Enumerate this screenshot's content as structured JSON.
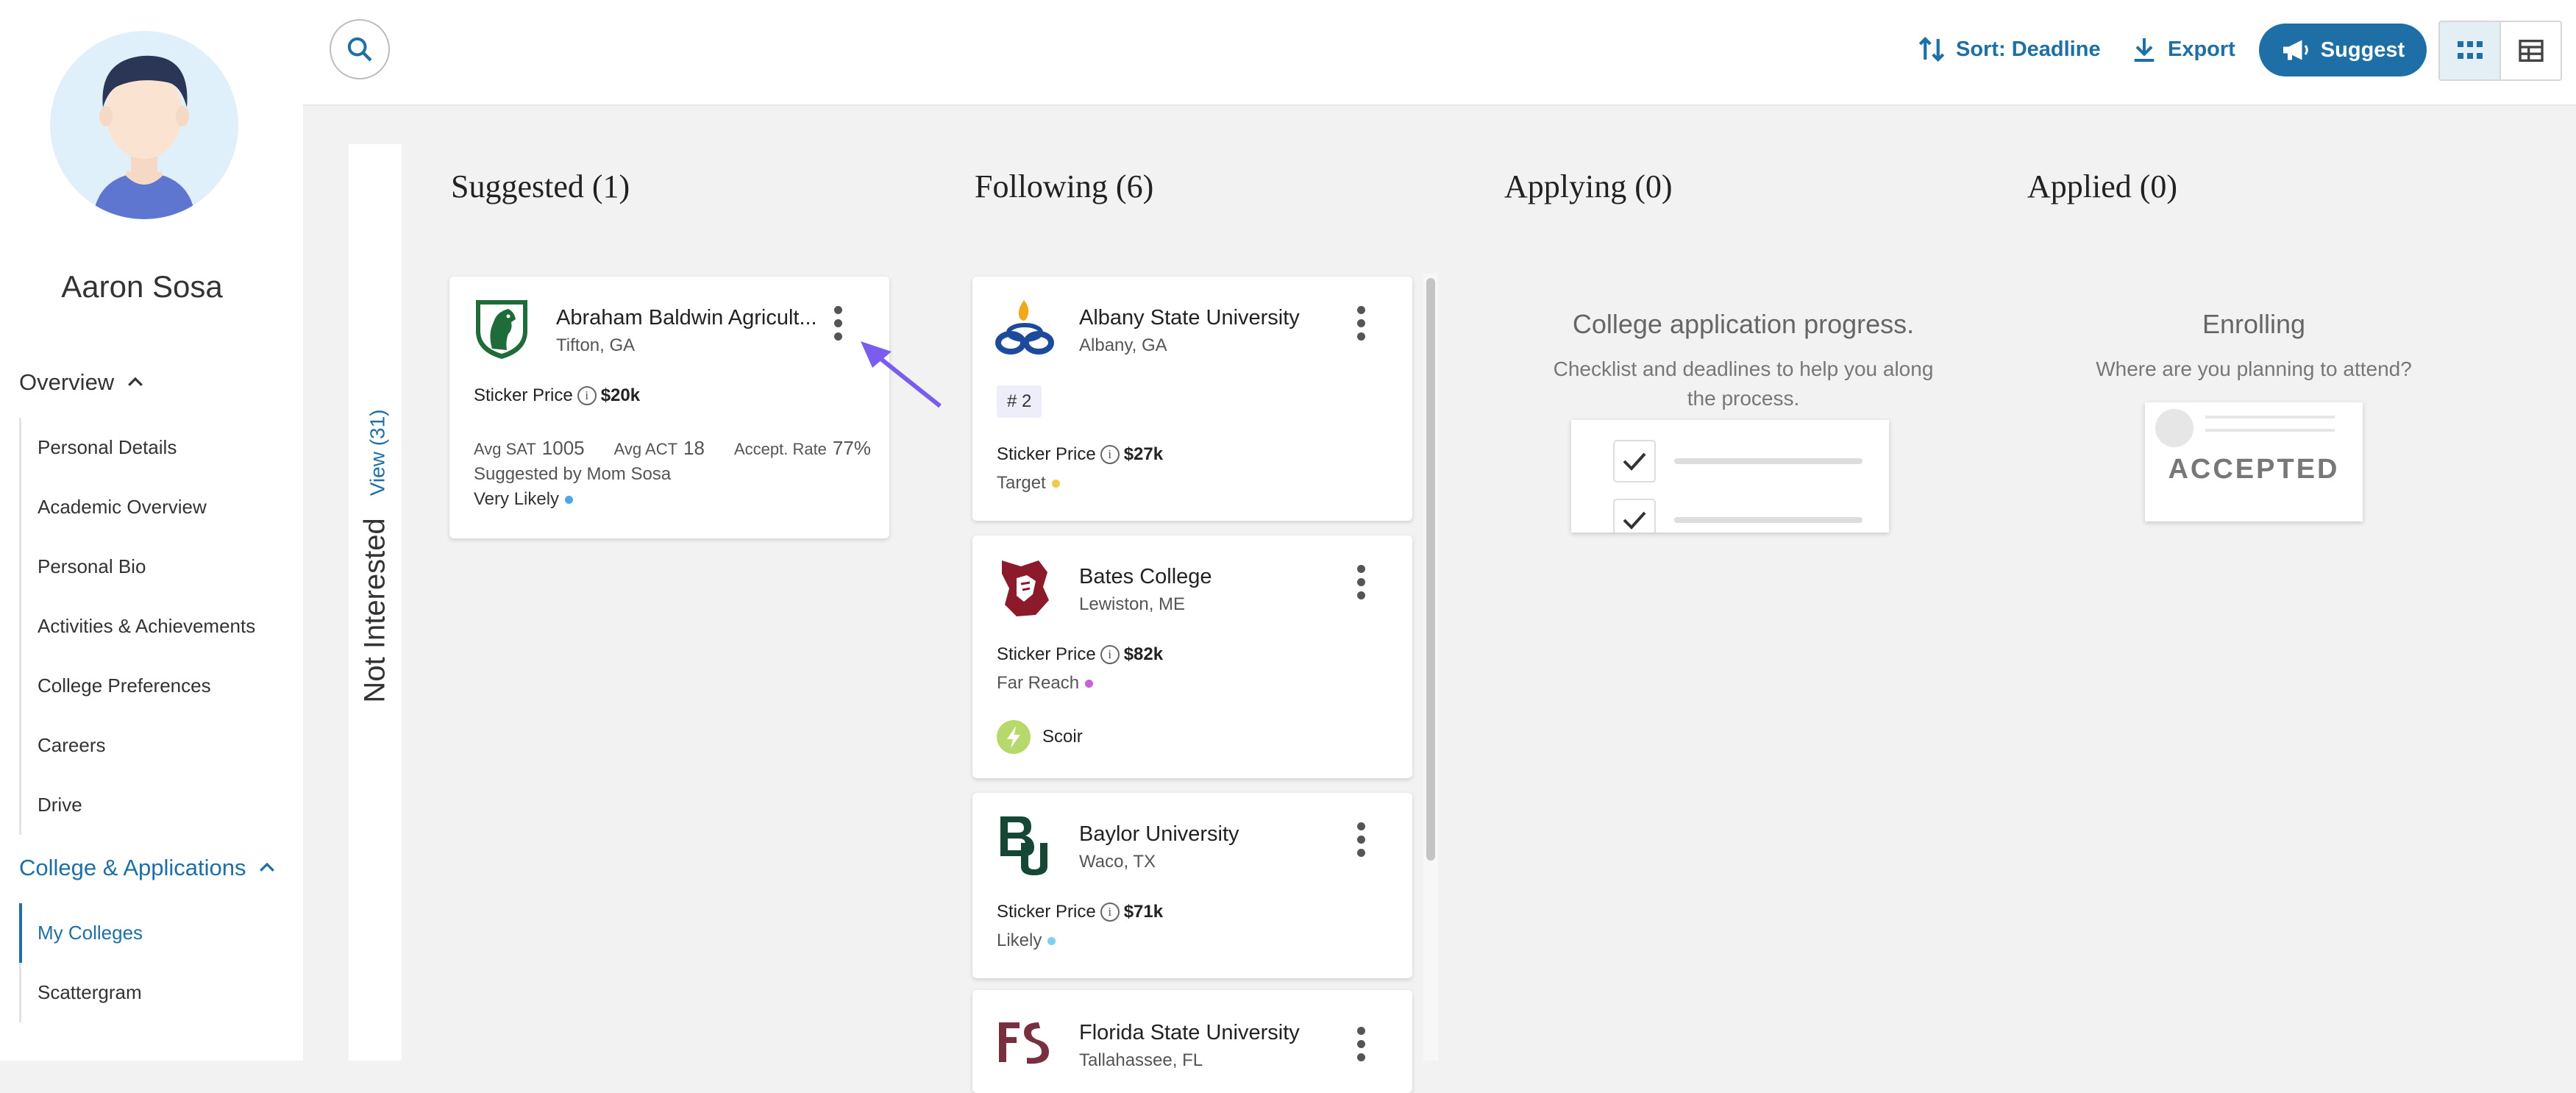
{
  "user": {
    "name": "Aaron Sosa"
  },
  "sidebar": {
    "overview": {
      "label": "Overview",
      "items": [
        "Personal Details",
        "Academic Overview",
        "Personal Bio",
        "Activities & Achievements",
        "College Preferences",
        "Careers",
        "Drive"
      ]
    },
    "colleges": {
      "label": "College & Applications",
      "items": [
        "My Colleges",
        "Scattergram"
      ]
    }
  },
  "toolbar": {
    "sort_label": "Sort: Deadline",
    "export_label": "Export",
    "suggest_label": "Suggest"
  },
  "not_interested": {
    "label": "Not Interested",
    "view_label": "View (31)"
  },
  "columns": {
    "suggested": {
      "title": "Suggested (1)",
      "card": {
        "name": "Abraham Baldwin Agricult...",
        "location": "Tifton, GA",
        "price_label": "Sticker Price",
        "price": "$20k",
        "sat_label": "Avg SAT",
        "sat": "1005",
        "act_label": "Avg ACT",
        "act": "18",
        "rate_label": "Accept. Rate",
        "rate": "77%",
        "suggested_by": "Suggested by Mom Sosa",
        "likelihood": "Very Likely",
        "likelihood_color": "#4aa8e8"
      }
    },
    "following": {
      "title": "Following (6)",
      "cards": [
        {
          "name": "Albany State University",
          "location": "Albany, GA",
          "rank": "# 2",
          "price_label": "Sticker Price",
          "price": "$27k",
          "category": "Target",
          "category_color": "#f2c94c"
        },
        {
          "name": "Bates College",
          "location": "Lewiston, ME",
          "price_label": "Sticker Price",
          "price": "$82k",
          "category": "Far Reach",
          "category_color": "#c961d8",
          "source": "Scoir"
        },
        {
          "name": "Baylor University",
          "location": "Waco, TX",
          "price_label": "Sticker Price",
          "price": "$71k",
          "category": "Likely",
          "category_color": "#7fd0ef"
        },
        {
          "name": "Florida State University",
          "location": "Tallahassee, FL"
        }
      ]
    },
    "applying": {
      "title": "Applying (0)",
      "empty_title": "College application progress.",
      "empty_sub": "Checklist and deadlines to help you along the process."
    },
    "applied": {
      "title": "Applied (0)",
      "empty_title": "Enrolling",
      "empty_sub": "Where are you planning to attend?",
      "stamp": "ACCEPTED"
    }
  },
  "colors": {
    "accent": "#1d6fa5",
    "annotation_arrow": "#7b5cf0"
  }
}
